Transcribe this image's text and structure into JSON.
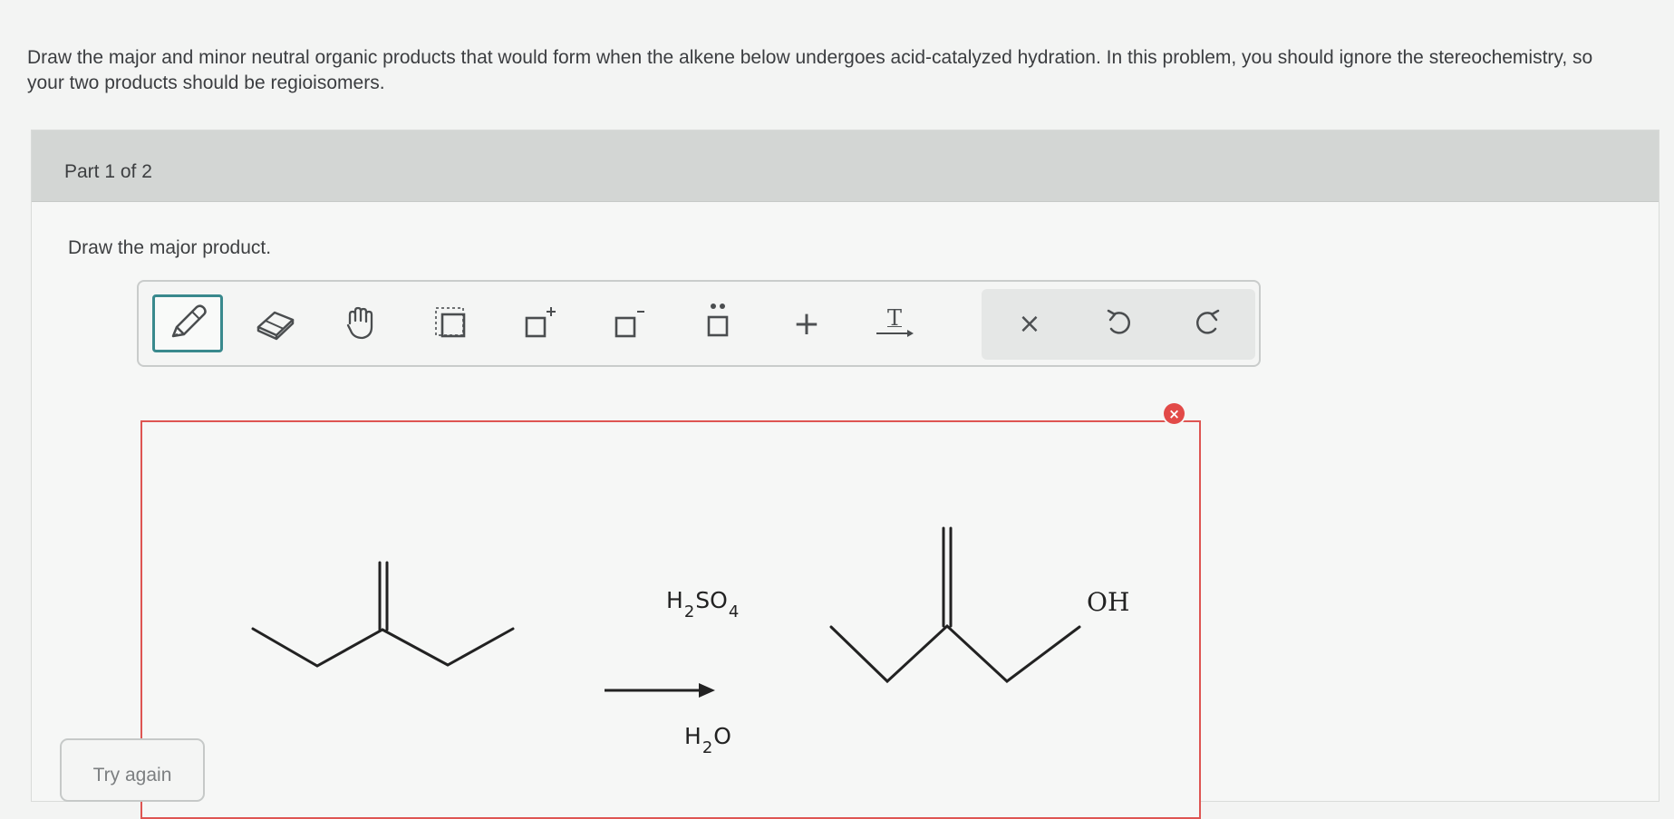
{
  "question": {
    "text": "Draw the major and minor neutral organic products that would form when the alkene below undergoes acid-catalyzed hydration. In this problem, you should ignore the stereochemistry, so your two products should be regioisomers."
  },
  "part": {
    "title": "Part 1 of 2",
    "instruction": "Draw the major product."
  },
  "toolbar": {
    "tools": [
      {
        "name": "pencil-icon",
        "active": true
      },
      {
        "name": "eraser-icon"
      },
      {
        "name": "hand-icon"
      },
      {
        "name": "select-box-icon"
      },
      {
        "name": "positive-charge-icon"
      },
      {
        "name": "negative-charge-icon"
      },
      {
        "name": "lone-pair-icon"
      },
      {
        "name": "plus-icon",
        "glyph": "+"
      },
      {
        "name": "text-arrow-icon",
        "glyph": "T"
      },
      {
        "name": "clear-icon",
        "glyph": "×"
      },
      {
        "name": "undo-icon"
      },
      {
        "name": "redo-icon"
      }
    ],
    "active_color": "#39898d"
  },
  "canvas": {
    "border_color": "#de5552",
    "error_badge": "×",
    "reagent_top": {
      "h": "H",
      "sub1": "2",
      "so": "SO",
      "sub2": "4"
    },
    "reagent_bottom": {
      "h": "H",
      "sub1": "2",
      "o": "O"
    },
    "product_label": "OH"
  },
  "actions": {
    "try_again": "Try again"
  }
}
